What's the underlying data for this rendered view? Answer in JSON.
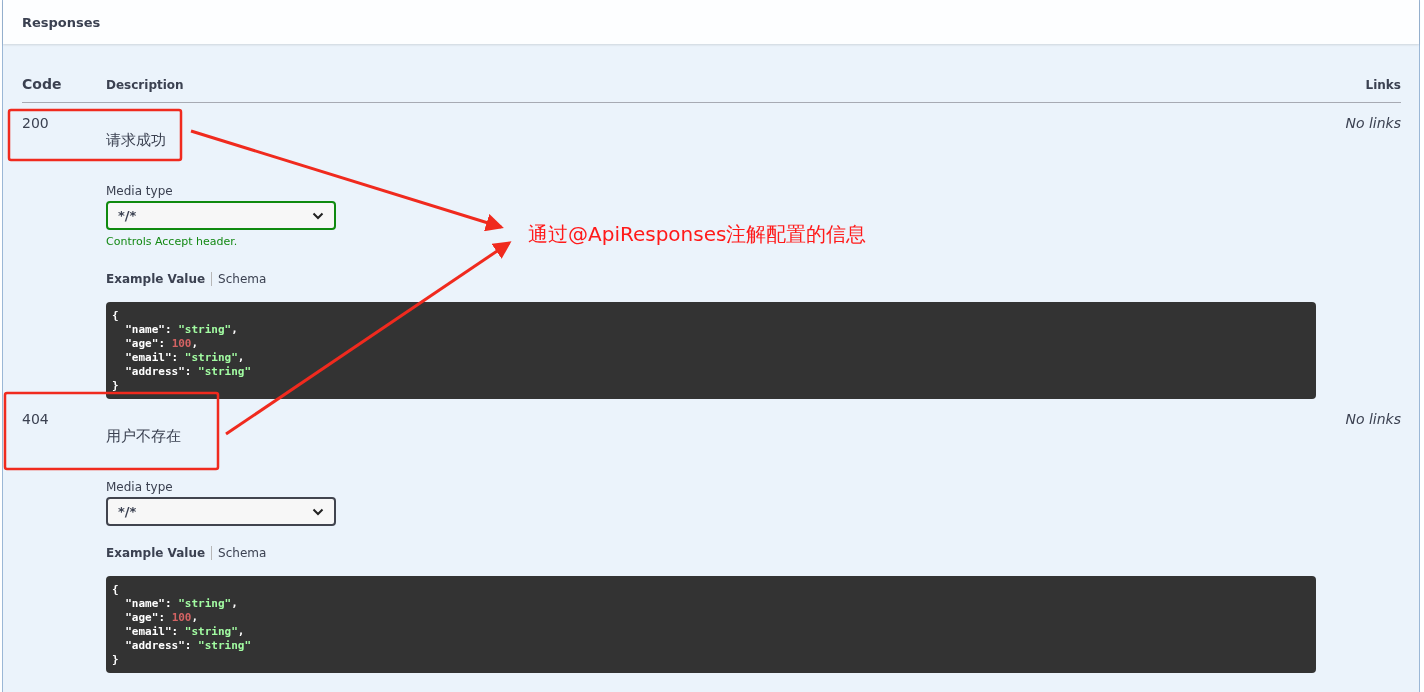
{
  "section": {
    "title": "Responses"
  },
  "columns": [
    {
      "label": "Code"
    },
    {
      "label": "Description"
    },
    {
      "label": "Links"
    }
  ],
  "responses": [
    {
      "code": "200",
      "description": "请求成功",
      "links": "No links",
      "media_type": {
        "label": "Media type",
        "value": "*/*",
        "accept_control": true,
        "hint": "Controls Accept header."
      },
      "example_tabs": [
        {
          "label": "Example Value",
          "selected": true
        },
        {
          "label": "Schema",
          "selected": false
        }
      ],
      "example": {
        "open": "{",
        "close": "}",
        "fields": [
          {
            "key": "\"name\"",
            "sep": ": ",
            "value": "\"string\"",
            "kind": "string",
            "tail": ","
          },
          {
            "key": "\"age\"",
            "sep": ": ",
            "value": "100",
            "kind": "number",
            "tail": ","
          },
          {
            "key": "\"email\"",
            "sep": ": ",
            "value": "\"string\"",
            "kind": "string",
            "tail": ","
          },
          {
            "key": "\"address\"",
            "sep": ": ",
            "value": "\"string\"",
            "kind": "string"
          }
        ]
      }
    },
    {
      "code": "404",
      "description": "用户不存在",
      "links": "No links",
      "media_type": {
        "label": "Media type",
        "value": "*/*",
        "accept_control": false
      },
      "example_tabs": [
        {
          "label": "Example Value",
          "selected": true
        },
        {
          "label": "Schema",
          "selected": false
        }
      ],
      "example": {
        "open": "{",
        "close": "}",
        "fields": [
          {
            "key": "\"name\"",
            "sep": ": ",
            "value": "\"string\"",
            "kind": "string",
            "tail": ","
          },
          {
            "key": "\"age\"",
            "sep": ": ",
            "value": "100",
            "kind": "number",
            "tail": ","
          },
          {
            "key": "\"email\"",
            "sep": ": ",
            "value": "\"string\"",
            "kind": "string",
            "tail": ","
          },
          {
            "key": "\"address\"",
            "sep": ": ",
            "value": "\"string\"",
            "kind": "string"
          }
        ]
      }
    }
  ],
  "annotation": {
    "text": "通过@ApiResponses注解配置的信息"
  }
}
